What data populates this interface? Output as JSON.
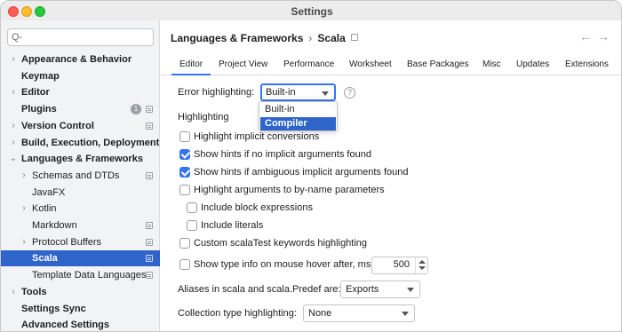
{
  "window": {
    "title": "Settings"
  },
  "search": {
    "placeholder": "Q-"
  },
  "sidebar": {
    "items": [
      {
        "label": "Appearance & Behavior",
        "bold": true,
        "arrow": "›",
        "level": 0
      },
      {
        "label": "Keymap",
        "bold": true,
        "arrow": "",
        "level": 0
      },
      {
        "label": "Editor",
        "bold": true,
        "arrow": "›",
        "level": 0
      },
      {
        "label": "Plugins",
        "bold": true,
        "arrow": "",
        "level": 0,
        "badge": "1",
        "project": true
      },
      {
        "label": "Version Control",
        "bold": true,
        "arrow": "›",
        "level": 0,
        "project": true
      },
      {
        "label": "Build, Execution, Deployment",
        "bold": true,
        "arrow": "›",
        "level": 0
      },
      {
        "label": "Languages & Frameworks",
        "bold": true,
        "arrow": "⌄",
        "level": 0
      },
      {
        "label": "Schemas and DTDs",
        "bold": false,
        "arrow": "›",
        "level": 1,
        "project": true
      },
      {
        "label": "JavaFX",
        "bold": false,
        "arrow": "",
        "level": 1
      },
      {
        "label": "Kotlin",
        "bold": false,
        "arrow": "›",
        "level": 1
      },
      {
        "label": "Markdown",
        "bold": false,
        "arrow": "",
        "level": 1,
        "project": true
      },
      {
        "label": "Protocol Buffers",
        "bold": false,
        "arrow": "›",
        "level": 1,
        "project": true
      },
      {
        "label": "Scala",
        "bold": true,
        "arrow": "",
        "level": 1,
        "project": true,
        "selected": true
      },
      {
        "label": "Template Data Languages",
        "bold": false,
        "arrow": "",
        "level": 1,
        "project": true
      },
      {
        "label": "Tools",
        "bold": true,
        "arrow": "›",
        "level": 0
      },
      {
        "label": "Settings Sync",
        "bold": true,
        "arrow": "",
        "level": 0
      },
      {
        "label": "Advanced Settings",
        "bold": true,
        "arrow": "",
        "level": 0
      }
    ]
  },
  "header": {
    "breadcrumb_parent": "Languages & Frameworks",
    "breadcrumb_sep": "›",
    "breadcrumb_current": "Scala",
    "back_icon": "←",
    "forward_icon": "→"
  },
  "tabs": [
    {
      "label": "Editor",
      "active": true
    },
    {
      "label": "Project View"
    },
    {
      "label": "Performance"
    },
    {
      "label": "Worksheet"
    },
    {
      "label": "Base Packages"
    },
    {
      "label": "Misc"
    },
    {
      "label": "Updates"
    },
    {
      "label": "Extensions"
    }
  ],
  "error_highlighting": {
    "label": "Error highlighting:",
    "value": "Built-in",
    "help": "?",
    "options": [
      "Built-in",
      "Compiler"
    ],
    "hovered_option": "Compiler"
  },
  "highlighting": {
    "title": "Highlighting",
    "options": [
      {
        "label": "Highlight implicit conversions",
        "checked": false,
        "indent": false
      },
      {
        "label": "Show hints if no implicit arguments found",
        "checked": true,
        "indent": false
      },
      {
        "label": "Show hints if ambiguous implicit arguments found",
        "checked": true,
        "indent": false
      },
      {
        "label": "Highlight arguments to by-name parameters",
        "checked": false,
        "indent": false
      },
      {
        "label": "Include block expressions",
        "checked": false,
        "indent": true
      },
      {
        "label": "Include literals",
        "checked": false,
        "indent": true
      },
      {
        "label": "Custom scalaTest keywords highlighting",
        "checked": false,
        "indent": false
      }
    ]
  },
  "type_info": {
    "label": "Show type info on mouse hover after, ms",
    "checked": false,
    "value": "500"
  },
  "aliases": {
    "label": "Aliases in scala and scala.Predef are:",
    "value": "Exports"
  },
  "collection": {
    "label": "Collection type highlighting:",
    "value": "None"
  },
  "colors": {
    "accent": "#3574f0",
    "selection": "#2f65ca",
    "sidebar_bg": "#f2f3f5"
  }
}
